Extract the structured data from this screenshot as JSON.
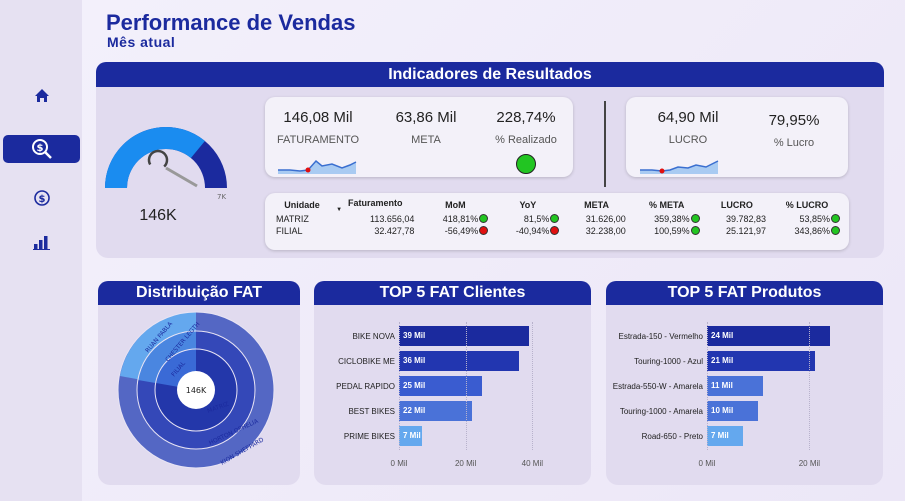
{
  "header": {
    "title": "Performance de Vendas",
    "subtitle": "Mês atual"
  },
  "sidebar": {
    "items": [
      "home-icon",
      "search-dollar-icon",
      "dollar-icon",
      "bar-chart-icon"
    ],
    "active": 1
  },
  "indicators": {
    "banner": "Indicadores de Resultados",
    "gauge": {
      "value_label": "146K",
      "max_label": "7K",
      "fill_fraction": 0.72
    },
    "faturamento": {
      "value": "146,08 Mil",
      "label": "FATURAMENTO"
    },
    "meta": {
      "value": "63,86 Mil",
      "label": "META"
    },
    "realizado": {
      "value": "228,74%",
      "label": "% Realizado",
      "status": "#22c522"
    },
    "lucro": {
      "value": "64,90 Mil",
      "label": "LUCRO"
    },
    "pct_lucro": {
      "value": "79,95%",
      "label": "% Lucro"
    }
  },
  "table": {
    "headers": [
      "Unidade",
      "Faturamento",
      "MoM",
      "YoY",
      "META",
      "% META",
      "LUCRO",
      "% LUCRO"
    ],
    "rows": [
      {
        "unidade": "MATRIZ",
        "faturamento": "113.656,04",
        "mom": "418,81%",
        "mom_s": "g",
        "yoy": "81,5%",
        "yoy_s": "g",
        "meta": "31.626,00",
        "pmeta": "359,38%",
        "pmeta_s": "g",
        "lucro": "39.782,83",
        "plucro": "53,85%",
        "plucro_s": "g"
      },
      {
        "unidade": "FILIAL",
        "faturamento": "32.427,78",
        "mom": "-56,49%",
        "mom_s": "r",
        "yoy": "-40,94%",
        "yoy_s": "r",
        "meta": "32.238,00",
        "pmeta": "100,59%",
        "pmeta_s": "g",
        "lucro": "25.121,97",
        "plucro": "343,86%",
        "plucro_s": "g"
      }
    ]
  },
  "distribution": {
    "banner": "Distribuição FAT",
    "center_label": "146K",
    "ring_labels": [
      "RUAN PABLA",
      "CHESTER LEGTH",
      "FILIAL",
      "MATRIZ",
      "HORTON OPHELIA",
      "KION SHEPPARD"
    ]
  },
  "chart_data": [
    {
      "type": "bar",
      "title": "TOP 5 FAT Clientes",
      "orientation": "horizontal",
      "categories": [
        "BIKE NOVA",
        "CICLOBIKE ME",
        "PEDAL RAPIDO",
        "BEST BIKES",
        "PRIME BIKES"
      ],
      "values": [
        39,
        36,
        25,
        22,
        7
      ],
      "data_labels": [
        "39 Mil",
        "36 Mil",
        "25 Mil",
        "22 Mil",
        "7 Mil"
      ],
      "colors": [
        "#1b2a9e",
        "#2236b0",
        "#3a5cd0",
        "#4a72d8",
        "#64a8ee"
      ],
      "xticks": [
        "0 Mil",
        "20 Mil",
        "40 Mil"
      ],
      "xlim": [
        0,
        45
      ]
    },
    {
      "type": "bar",
      "title": "TOP 5 FAT Produtos",
      "orientation": "horizontal",
      "categories": [
        "Estrada-150 - Vermelho",
        "Touring-1000 - Azul",
        "Estrada-550-W - Amarela",
        "Touring-1000 - Amarela",
        "Road-650 - Preto"
      ],
      "values": [
        24,
        21,
        11,
        10,
        7
      ],
      "data_labels": [
        "24 Mil",
        "21 Mil",
        "11 Mil",
        "10 Mil",
        "7 Mil"
      ],
      "colors": [
        "#1b2a9e",
        "#2236b0",
        "#4a72d8",
        "#4a72d8",
        "#64a8ee"
      ],
      "xticks": [
        "0 Mil",
        "20 Mil"
      ],
      "xlim": [
        0,
        25
      ]
    }
  ]
}
